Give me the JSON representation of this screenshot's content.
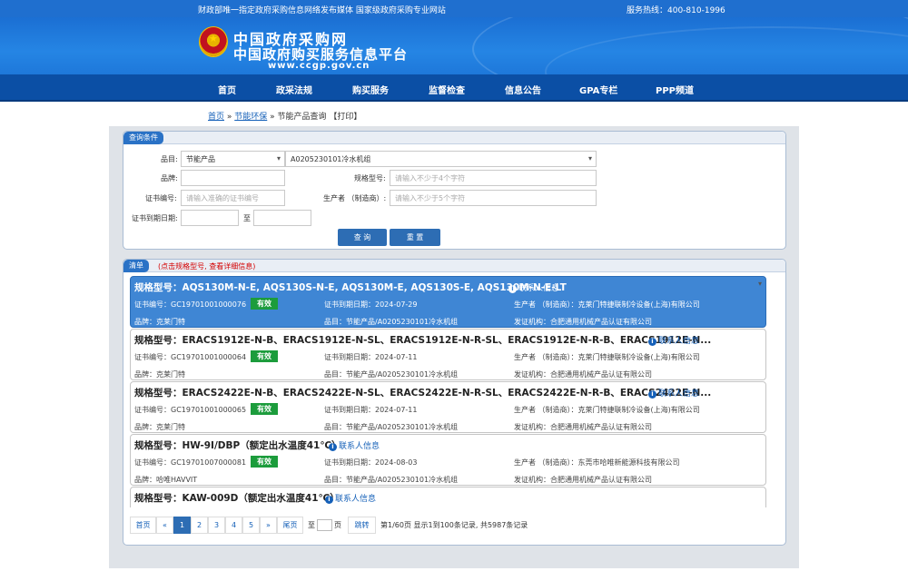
{
  "topbar": {
    "left": "财政部唯一指定政府采购信息网络发布媒体 国家级政府采购专业网站",
    "right": "服务热线：400-810-1996"
  },
  "header": {
    "title1": "中国政府采购网",
    "title2": "中国政府购买服务信息平台",
    "url": "www.ccgp.gov.cn"
  },
  "nav": [
    "首页",
    "政采法规",
    "购买服务",
    "监督检查",
    "信息公告",
    "GPA专栏",
    "PPP频道"
  ],
  "breadcrumb": {
    "home": "首页",
    "sep1": " » ",
    "section": "节能环保",
    "sep2": " » ",
    "current": "节能产品查询",
    "print": "【打印】"
  },
  "query": {
    "tab": "查询条件",
    "category_label": "品目:",
    "category_value": "节能产品",
    "category_sub_value": "A0205230101冷水机组",
    "brand_label": "品牌:",
    "brand_value": "",
    "model_label": "规格型号:",
    "model_placeholder": "请输入不少于4个字符",
    "cert_label": "证书编号:",
    "cert_placeholder": "请输入准确的证书编号",
    "producer_label": "生产者 （制造商）:",
    "producer_placeholder": "请输入不少于5个字符",
    "expire_label": "证书到期日期:",
    "expire_from": "",
    "to_label": "至",
    "expire_to": "",
    "search_button": "查 询",
    "reset_button": "重 置"
  },
  "results": {
    "tab": "清单",
    "tip": "(点击规格型号, 查看详细信息)",
    "contact_label": "联系人信息",
    "items": [
      {
        "model": "规格型号：AQS130M-N-E, AQS130S-N-E, AQS130M-E, AQS130S-E, AQS130M-N-E-LT",
        "cert": "证书编号：GC19701001000076",
        "status": "有效",
        "expire": "证书到期日期：2024-07-29",
        "producer": "生产者 （制造商）：克莱门特捷联制冷设备(上海)有限公司",
        "brand": "品牌：克莱门特",
        "category": "品目：节能产品/A0205230101冷水机组",
        "issuer": "发证机构：合肥通用机械产品认证有限公司"
      },
      {
        "model": "规格型号：ERACS1912E-N-B、ERACS1912E-N-SL、ERACS1912E-N-R-SL、ERACS1912E-N-R-B、ERACS1912E-N...",
        "cert": "证书编号：GC19701001000064",
        "status": "有效",
        "expire": "证书到期日期：2024-07-11",
        "producer": "生产者 （制造商）：克莱门特捷联制冷设备(上海)有限公司",
        "brand": "品牌：克莱门特",
        "category": "品目：节能产品/A0205230101冷水机组",
        "issuer": "发证机构：合肥通用机械产品认证有限公司"
      },
      {
        "model": "规格型号：ERACS2422E-N-B、ERACS2422E-N-SL、ERACS2422E-N-R-SL、ERACS2422E-N-R-B、ERACS2422E-N...",
        "cert": "证书编号：GC19701001000065",
        "status": "有效",
        "expire": "证书到期日期：2024-07-11",
        "producer": "生产者 （制造商）：克莱门特捷联制冷设备(上海)有限公司",
        "brand": "品牌：克莱门特",
        "category": "品目：节能产品/A0205230101冷水机组",
        "issuer": "发证机构：合肥通用机械产品认证有限公司"
      },
      {
        "model": "规格型号：HW-9I/DBP（额定出水温度41℃）",
        "cert": "证书编号：GC19701007000081",
        "status": "有效",
        "expire": "证书到期日期：2024-08-03",
        "producer": "生产者 （制造商）：东莞市哈唯新能源科技有限公司",
        "brand": "品牌：哈唯HAVVIT",
        "category": "品目：节能产品/A0205230101冷水机组",
        "issuer": "发证机构：合肥通用机械产品认证有限公司"
      },
      {
        "model": "规格型号：KAW-009D（额定出水温度41℃）"
      }
    ]
  },
  "pager": {
    "first": "首页",
    "prev": "«",
    "pages": [
      "1",
      "2",
      "3",
      "4",
      "5"
    ],
    "next": "»",
    "last": "尾页",
    "goto_prefix": "至",
    "goto_suffix": "页",
    "jump": "跳转",
    "info": "第1/60页 显示1到100条记录, 共5987条记录"
  }
}
